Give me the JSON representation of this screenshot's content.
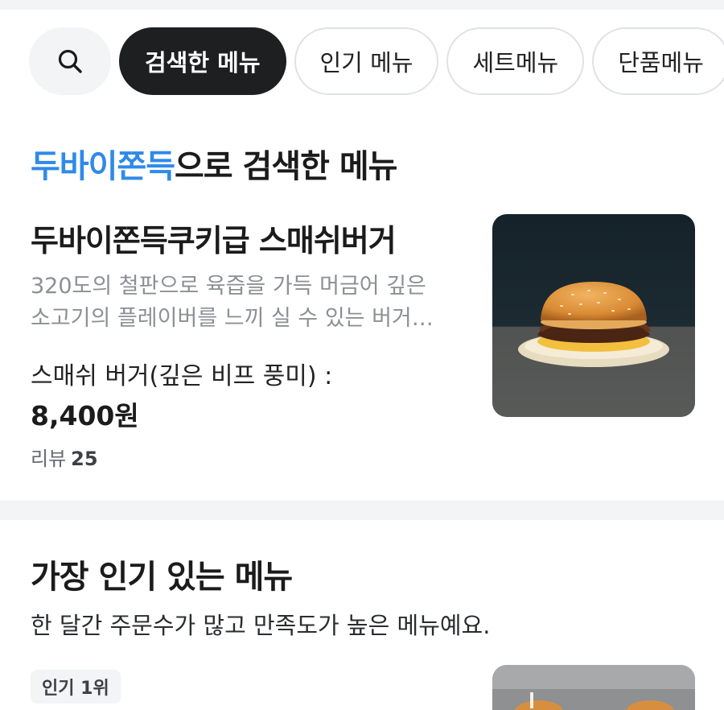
{
  "filters": {
    "search_icon": "search-icon",
    "chips": [
      {
        "label": "검색한 메뉴",
        "active": true
      },
      {
        "label": "인기 메뉴",
        "active": false
      },
      {
        "label": "세트메뉴",
        "active": false
      },
      {
        "label": "단품메뉴",
        "active": false
      }
    ]
  },
  "searched_section": {
    "keyword": "두바이쫀득",
    "title_suffix": "으로 검색한 메뉴",
    "item": {
      "name": "두바이쫀득쿠키급 스매쉬버거",
      "description_line1": "320도의 철판으로 육즙을 가득 머금어 깊은",
      "description_line2": "소고기의 플레이버를 느끼 실 수 있는 버거…",
      "option": "스매쉬 버거(깊은 비프 풍미) :",
      "price": "8,400원",
      "review_label": "리뷰",
      "review_count": "25"
    }
  },
  "popular_section": {
    "title": "가장 인기 있는 메뉴",
    "subtitle": "한 달간 주문수가 많고 만족도가 높은 메뉴예요.",
    "first_item": {
      "rank_badge": "인기 1위"
    }
  },
  "colors": {
    "accent": "#2f8ae8",
    "chip_active_bg": "#1d1f21",
    "muted_text": "#8c8f94",
    "section_bg": "#f2f4f6"
  }
}
